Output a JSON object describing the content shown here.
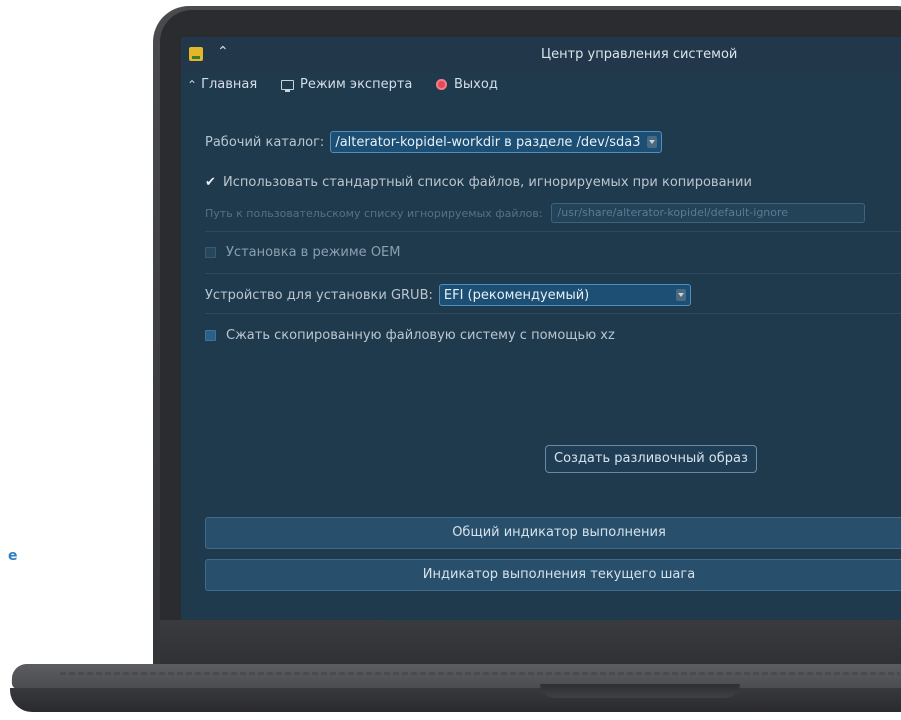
{
  "window": {
    "title": "Центр управления системой",
    "icons": {
      "app": "app-icon",
      "collapse": "chevron-up-icon"
    }
  },
  "toolbar": {
    "home_label": "Главная",
    "expert_label": "Режим эксперта",
    "exit_label": "Выход"
  },
  "form": {
    "workdir_label": "Рабочий каталог:",
    "workdir_value": "/alterator-kopidel-workdir в разделе /dev/sda3",
    "use_default_list_label": "Использовать стандартный список файлов, игнорируемых при копировании",
    "use_default_list_checked": true,
    "custom_list_label": "Путь к пользовательскому списку игнорируемых файлов:",
    "custom_list_value": "/usr/share/alterator-kopidel/default-ignore",
    "oem_label": "Установка в режиме OEM",
    "oem_checked": false,
    "grub_label": "Устройство для установки GRUB:",
    "grub_value": "EFI (рекомендуемый)",
    "compress_label": "Сжать скопированную файловую систему с помощью xz",
    "compress_checked": false
  },
  "actions": {
    "create_image_label": "Создать разливочный образ"
  },
  "progress": {
    "overall_label": "Общий индикатор выполнения",
    "overall_value": 0,
    "step_label": "Индикатор выполнения текущего шага",
    "step_value": 0
  },
  "side_mark": "e",
  "colors": {
    "window_bg": "#203a4d",
    "accent": "#4f8fbf",
    "exit_icon": "#e5485a"
  }
}
